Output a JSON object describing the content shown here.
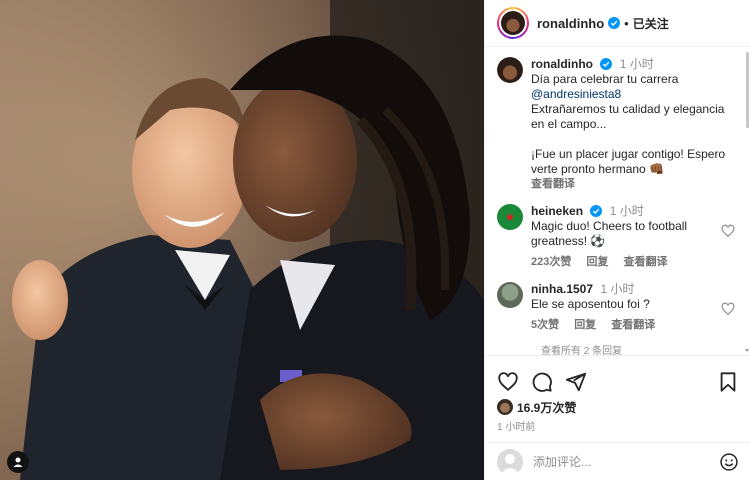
{
  "header": {
    "username": "ronaldinho",
    "separator": "•",
    "follow_status": "已关注"
  },
  "comments": [
    {
      "author": "ronaldinho",
      "time": "1 小时",
      "lines": [
        "Día para celebrar tu carrera"
      ],
      "mention": "@andresiniesta8",
      "para1": [
        "Extrañaremos tu calidad y elegancia",
        "en el campo..."
      ],
      "para2": [
        "¡Fue un placer jugar contigo! Espero",
        "verte pronto hermano 👊🏾"
      ],
      "translate": "查看翻译"
    },
    {
      "author": "heineken",
      "time": "1 小时",
      "text": "Magic duo! Cheers to football greatness! ⚽",
      "likes": "223次赞",
      "reply": "回复",
      "translate": "查看翻译"
    },
    {
      "author": "ninha.1507",
      "time": "1 小时",
      "text": "Ele se aposentou foi ?",
      "likes": "5次赞",
      "reply": "回复",
      "translate": "查看翻译"
    }
  ],
  "view_replies": "查看所有 2 条回复",
  "post": {
    "likes": "16.9万次赞",
    "posted": "1 小时前"
  },
  "composer": {
    "placeholder": "添加评论..."
  },
  "icons": {
    "like": "heart-icon",
    "comment": "comment-icon",
    "share": "share-icon",
    "save": "bookmark-icon",
    "emoji": "emoji-icon"
  },
  "colors": {
    "verified": "#0095f6",
    "mention": "#00376b",
    "muted": "#8e8e8e",
    "heineken": "#1a8a3a"
  }
}
